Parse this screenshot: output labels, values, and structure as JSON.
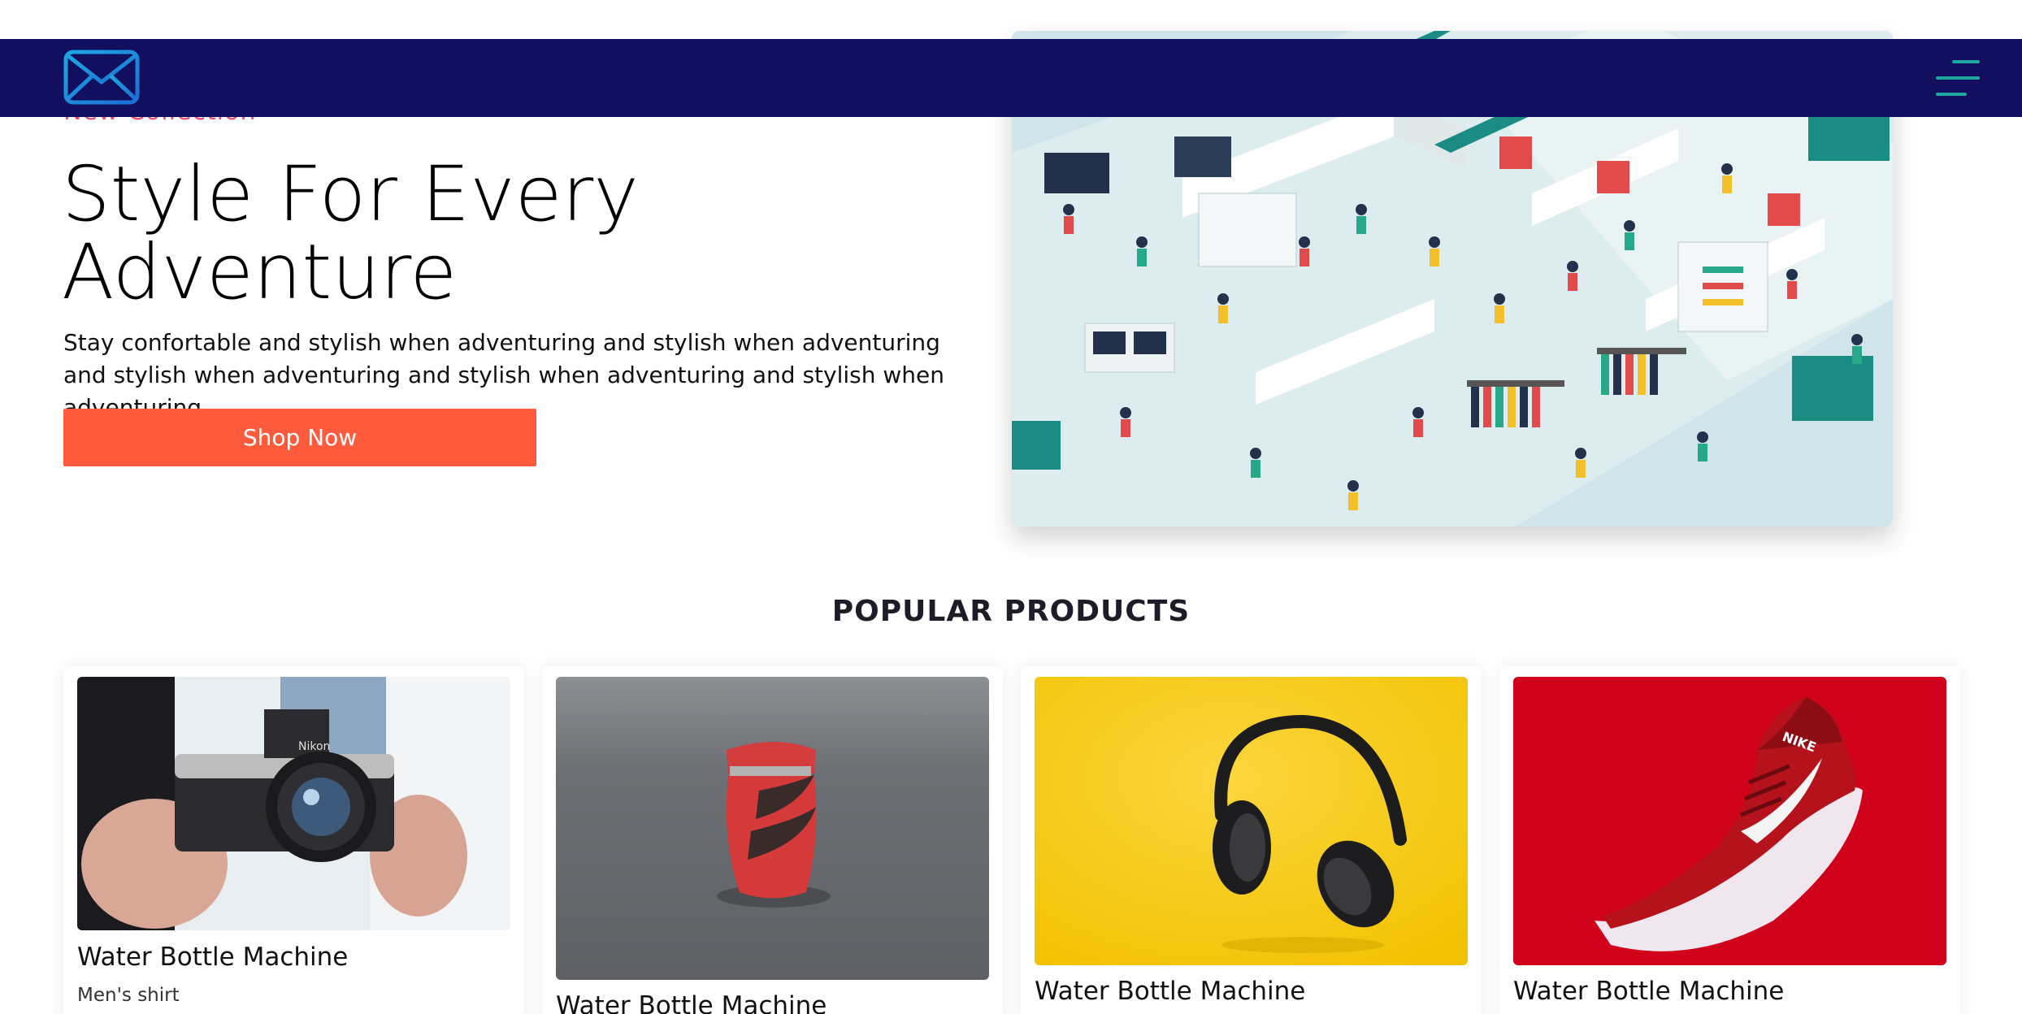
{
  "nav": {
    "logo_icon": "envelope-icon",
    "menu_icon": "hamburger-menu-icon",
    "background": "#110f5e",
    "accent": "#1ea7a0"
  },
  "hero": {
    "eyebrow": "New Collection",
    "title_line1": "Style For Every",
    "title_line2": "Adventure",
    "description": "Stay confortable and stylish when adventuring and stylish when adventuring and stylish when adventuring and stylish when adventuring and stylish when adventuring",
    "cta_label": "Shop Now",
    "cta_color": "#fe5a3c",
    "image": "isometric-shopping-mall-illustration"
  },
  "products_section": {
    "title": "POPULAR PRODUCTS",
    "items": [
      {
        "title": "Water Bottle Machine",
        "subtitle": "Men's shirt",
        "image": "camera-photo"
      },
      {
        "title": "Water Bottle Machine",
        "image": "red-lighter-photo"
      },
      {
        "title": "Water Bottle Machine",
        "image": "headphones-photo"
      },
      {
        "title": "Water Bottle Machine",
        "image": "red-sneaker-photo"
      }
    ]
  }
}
